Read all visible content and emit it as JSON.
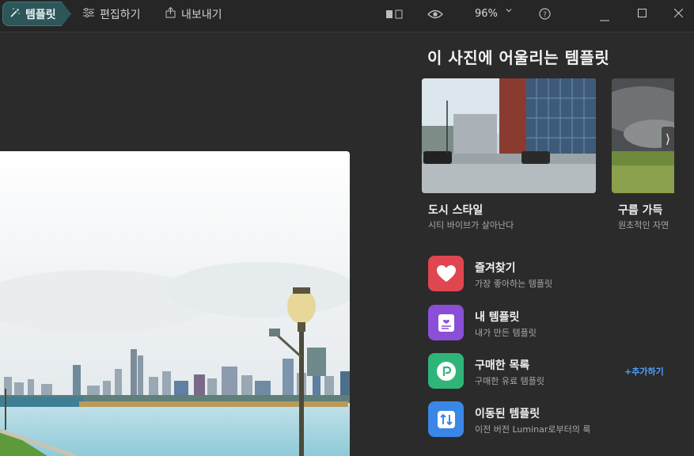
{
  "toolbar": {
    "tabs": [
      {
        "label": "템플릿",
        "icon": "magic-wand-icon",
        "active": true
      },
      {
        "label": "편집하기",
        "icon": "sliders-icon"
      },
      {
        "label": "내보내기",
        "icon": "export-icon"
      }
    ],
    "zoom": "96%",
    "help": "?"
  },
  "panel": {
    "title": "이 사진에 어울리는 템플릿",
    "cards": [
      {
        "name": "도시 스타일",
        "desc": "시티 바이브가 살아난다"
      },
      {
        "name": "구름 가득",
        "desc": "원초적인 자연"
      }
    ],
    "library": [
      {
        "name": "즐겨찾기",
        "desc": "가장 좋아하는 템플릿",
        "icon": "heart-icon",
        "color": "#e0464f"
      },
      {
        "name": "내 템플릿",
        "desc": "내가 만든 템플릿",
        "icon": "my-template-icon",
        "color": "#8a4fd6"
      },
      {
        "name": "구매한 목록",
        "desc": "구매한 유료 템플릿",
        "icon": "purchased-icon",
        "color": "#2fb57a",
        "action": "+추가하기"
      },
      {
        "name": "이동된 템플릿",
        "desc": "이전 버전 Luminar로부터의 룩",
        "icon": "migrate-icon",
        "color": "#3a87e8"
      }
    ]
  },
  "colors": {
    "accent": "#2d5659",
    "link": "#4fa1ff",
    "bg": "#2b2b2b"
  }
}
